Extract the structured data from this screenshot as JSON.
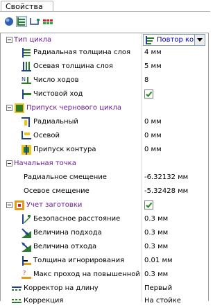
{
  "window": {
    "tab_label": "Свойства"
  },
  "toolbar": {
    "buttons": [
      "globe-icon",
      "tree-icon",
      "path-icon",
      "colors-icon"
    ]
  },
  "rows": {
    "cycle_type": {
      "label": "Тип цикла",
      "value": "Повтор ко"
    },
    "radial_layer": {
      "label": "Радиальная толщина слоя",
      "value": "4 мм"
    },
    "axial_layer": {
      "label": "Осевая толщина слоя",
      "value": "5 мм"
    },
    "passes": {
      "label": "Число ходов",
      "value": "8"
    },
    "finish": {
      "label": "Чистовой ход",
      "checked": true
    },
    "rough_allow": {
      "label": "Припуск чернового цикла"
    },
    "radial": {
      "label": "Радиальный",
      "value": "0 мм"
    },
    "axial": {
      "label": "Осевой",
      "value": "0 мм"
    },
    "contour_allow": {
      "label": "Припуск контура",
      "value": "0 мм"
    },
    "start_point": {
      "label": "Начальная точка"
    },
    "radial_offset": {
      "label": "Радиальное смещение",
      "value": "-6.32132 мм"
    },
    "axial_offset": {
      "label": "Осевое смещение",
      "value": "-5.32428 мм"
    },
    "stock": {
      "label": "Учет заготовки",
      "checked": true
    },
    "safe_dist": {
      "label": "Безопасное расстояние",
      "value": "0.3 мм"
    },
    "approach": {
      "label": "Величина подхода",
      "value": "0.3 мм"
    },
    "retract": {
      "label": "Величина отхода",
      "value": "0.3 мм"
    },
    "ignore_thick": {
      "label": "Толщина игнорирования",
      "value": "0.01 мм"
    },
    "max_pass": {
      "label": "Макс проход на повышенной",
      "value": "0.3 мм"
    },
    "len_corr": {
      "label": "Корректор на длину",
      "value": "Первый"
    },
    "correction": {
      "label": "Коррекция",
      "value": "На стойке"
    }
  },
  "colors": {
    "accent_purple": "#6a1b9a",
    "link_blue": "#0000cc",
    "check_green": "#1a8a1a"
  }
}
